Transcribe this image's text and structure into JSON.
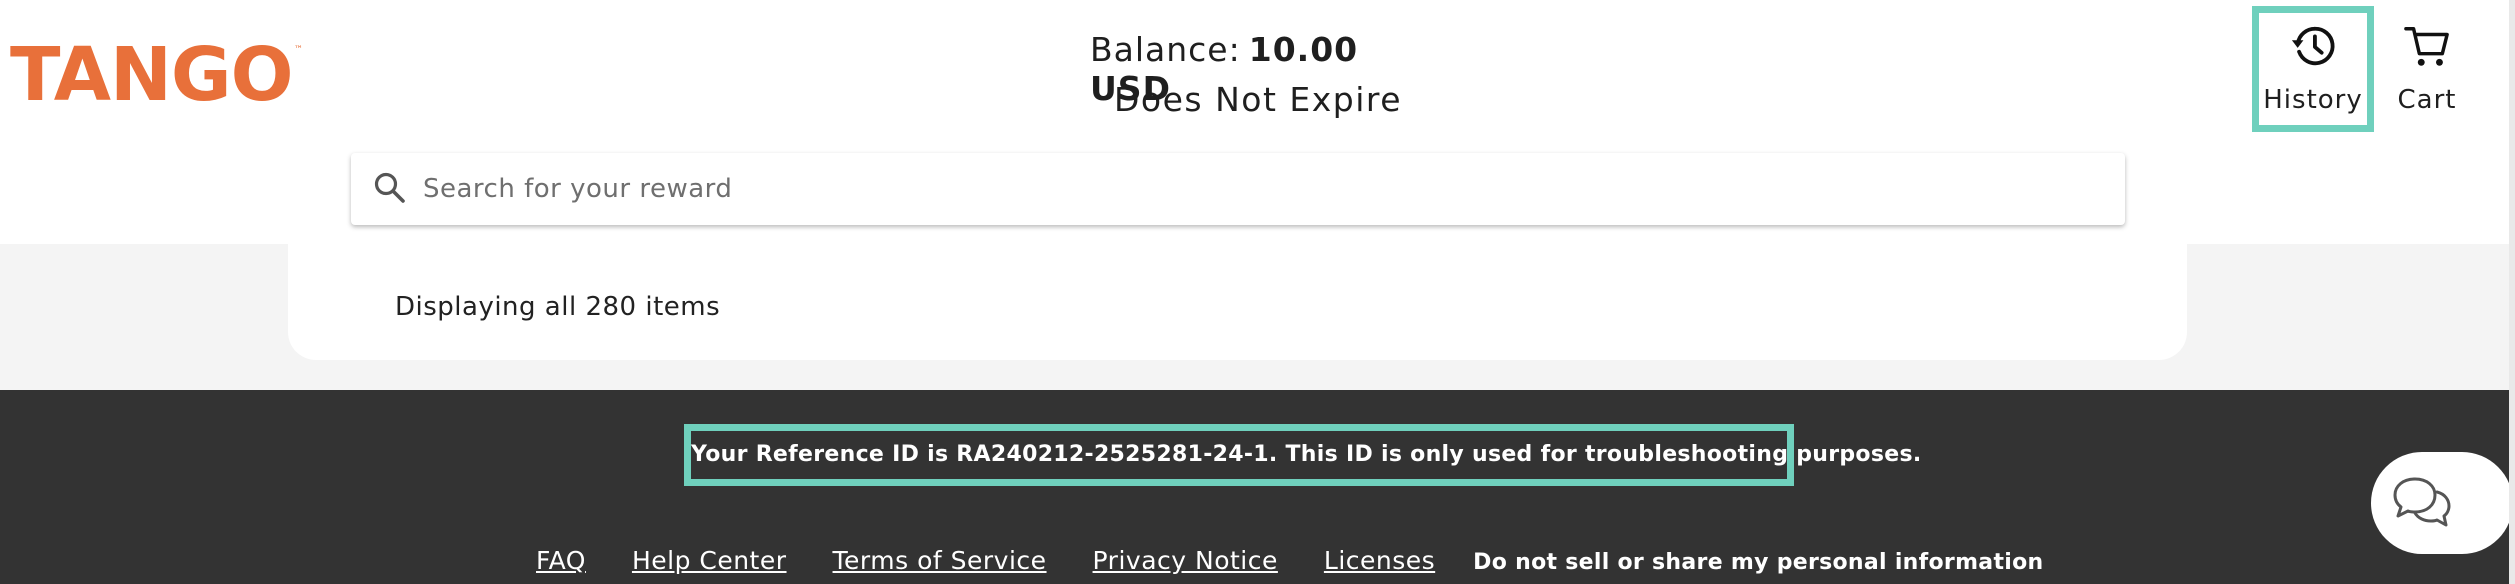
{
  "header": {
    "logo_text": "TANGO",
    "balance_label": "Balance:",
    "balance_value": "10.00 USD",
    "expiry": "Does Not Expire",
    "nav": {
      "history_label": "History",
      "cart_label": "Cart"
    }
  },
  "search": {
    "placeholder": "Search for your reward",
    "value": ""
  },
  "results": {
    "count_text": "Displaying all 280 items"
  },
  "footer": {
    "reference_text": "Your Reference ID is RA240212-2525281-24-1. This ID is only used for troubleshooting purposes.",
    "links": {
      "faq": "FAQ",
      "help_center": "Help Center",
      "terms": "Terms of Service",
      "privacy": "Privacy Notice",
      "licenses": "Licenses",
      "do_not_sell": "Do not sell or share my personal information"
    }
  },
  "colors": {
    "brand_orange": "#e8703a",
    "highlight_teal": "#6fd0bd",
    "footer_bg": "#333333"
  },
  "icons": [
    "history-icon",
    "cart-icon",
    "search-icon",
    "chat-icon"
  ]
}
